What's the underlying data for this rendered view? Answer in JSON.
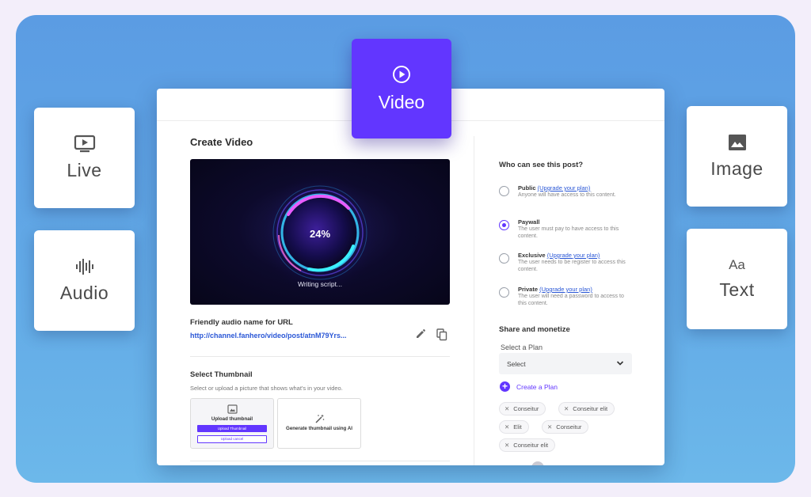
{
  "tiles": {
    "live": "Live",
    "audio": "Audio",
    "image": "Image",
    "text": "Text",
    "text_icon": "Aa",
    "video": "Video"
  },
  "icons": {
    "live": "monitor-play-icon",
    "audio": "waveform-icon",
    "image": "image-icon",
    "text": "text-aa-icon",
    "video": "play-circle-icon"
  },
  "create_video": {
    "title": "Create Video",
    "progress_label": "24%",
    "progress": 0.24,
    "status": "Writing script...",
    "url_label": "Friendly audio name for URL",
    "url_value": "http://channel.fanhero/video/post/atnM79Yrs...",
    "thumbnail_title": "Select Thumbnail",
    "thumbnail_sub": "Select or upload a picture that shows what's in your video.",
    "upload_title": "Upload thumbnail",
    "upload_button": "Upload Thumbnail",
    "upload_cancel": "Upload cancel",
    "generate_title": "Generate thumbnail using AI"
  },
  "visibility": {
    "title": "Who can see this post?",
    "options": [
      {
        "name": "Public",
        "link": "(Upgrade your plan)",
        "desc": "Anyone will have access to this content.",
        "selected": false
      },
      {
        "name": "Paywall",
        "link": "",
        "desc": "The user must pay to have access to this content.",
        "selected": true
      },
      {
        "name": "Exclusive",
        "link": "(Upgrade your plan)",
        "desc": "The user needs to be register to access this content.",
        "selected": false
      },
      {
        "name": "Private",
        "link": "(Upgrade your plan)",
        "desc": "The user will need a password to access to this content.",
        "selected": false
      }
    ]
  },
  "share": {
    "title": "Share and monetize",
    "plan_label": "Select a Plan",
    "select_value": "Select",
    "create_plan": "Create a Plan",
    "chips": [
      "Conseitur",
      "Conseitur  elit",
      "Elit",
      "Conseitur",
      "Conseitur  elit"
    ]
  },
  "colors": {
    "accent": "#6236ff",
    "link": "#2a57d6",
    "background": "#5b9ce3"
  }
}
